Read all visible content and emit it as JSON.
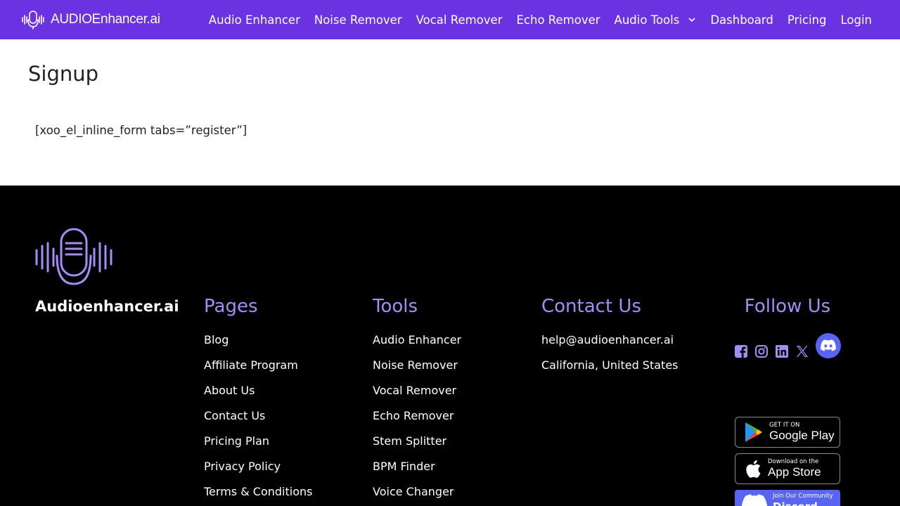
{
  "header": {
    "brand": "AUDIOEnhancer.ai",
    "nav": [
      {
        "label": "Audio Enhancer"
      },
      {
        "label": "Noise Remover"
      },
      {
        "label": "Vocal Remover"
      },
      {
        "label": "Echo Remover"
      },
      {
        "label": "Audio Tools",
        "icon": "chevron-down-icon"
      },
      {
        "label": "Dashboard"
      },
      {
        "label": "Pricing"
      },
      {
        "label": "Login"
      }
    ]
  },
  "main": {
    "title": "Signup",
    "shortcode": "[xoo_el_inline_form tabs=”register”]"
  },
  "footer": {
    "brand": "Audioenhancer.ai",
    "pages": {
      "heading": "Pages",
      "items": [
        "Blog",
        "Affiliate Program",
        "About Us",
        "Contact Us",
        "Pricing Plan",
        "Privacy Policy",
        "Terms & Conditions"
      ]
    },
    "tools": {
      "heading": "Tools",
      "items": [
        "Audio Enhancer",
        "Noise Remover",
        "Vocal Remover",
        "Echo Remover",
        "Stem Splitter",
        "BPM Finder",
        "Voice Changer"
      ]
    },
    "contact": {
      "heading": "Contact Us",
      "email": "help@audioenhancer.ai",
      "location": "California, United States"
    },
    "follow": {
      "heading": "Follow Us",
      "icons": [
        "facebook-icon",
        "instagram-icon",
        "linkedin-icon",
        "x-twitter-icon",
        "discord-icon"
      ]
    },
    "badges": {
      "google_play_small": "GET IT ON",
      "google_play_big": "Google Play",
      "app_store_small": "Download on the",
      "app_store_big": "App Store",
      "community_small": "Join Our Community",
      "community_big": "Discord"
    }
  },
  "colors": {
    "header_bg": "#6a32e0",
    "footer_bg": "#000000",
    "footer_heading": "#a48df5",
    "discord": "#5865f2"
  }
}
